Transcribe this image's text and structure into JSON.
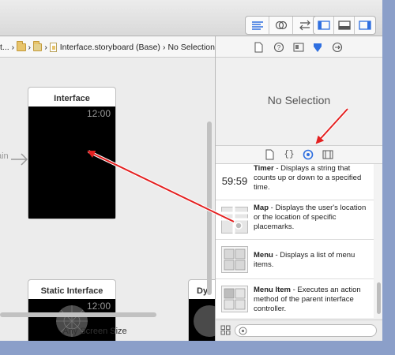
{
  "jumpbar": {
    "crumbs": [
      "t...",
      "Interface.storyboard (Base)",
      "No Selection"
    ]
  },
  "canvas": {
    "scene_main_title": "Interface",
    "scene_main_time": "12:00",
    "scene_static_title": "Static Interface",
    "scene_static_time": "12:00",
    "scene_partial_title": "Dy",
    "entry_label": "ain",
    "size_label": "Any Screen Size"
  },
  "inspector": {
    "no_selection": "No Selection",
    "tab_icons": [
      "file-icon",
      "quick-help-icon",
      "identity-icon",
      "attributes-icon",
      "connections-icon"
    ]
  },
  "library": {
    "tab_icons": [
      "file-template-icon",
      "code-snippet-icon",
      "object-library-icon",
      "media-library-icon"
    ],
    "items": [
      {
        "name": "Timer",
        "desc": " - Displays a string that counts up or down to a specified time.",
        "icon_text": "59:59"
      },
      {
        "name": "Map",
        "desc": " - Displays the user's location or the location of specific placemarks.",
        "icon_text": ""
      },
      {
        "name": "Menu",
        "desc": " - Displays a list of menu items.",
        "icon_text": ""
      },
      {
        "name": "Menu Item",
        "desc": " - Executes an action method of the parent interface controller.",
        "icon_text": ""
      }
    ]
  },
  "colors": {
    "accent": "#2f6fe0",
    "annotation_arrow": "#e32020",
    "watch_screen": "#000000"
  }
}
